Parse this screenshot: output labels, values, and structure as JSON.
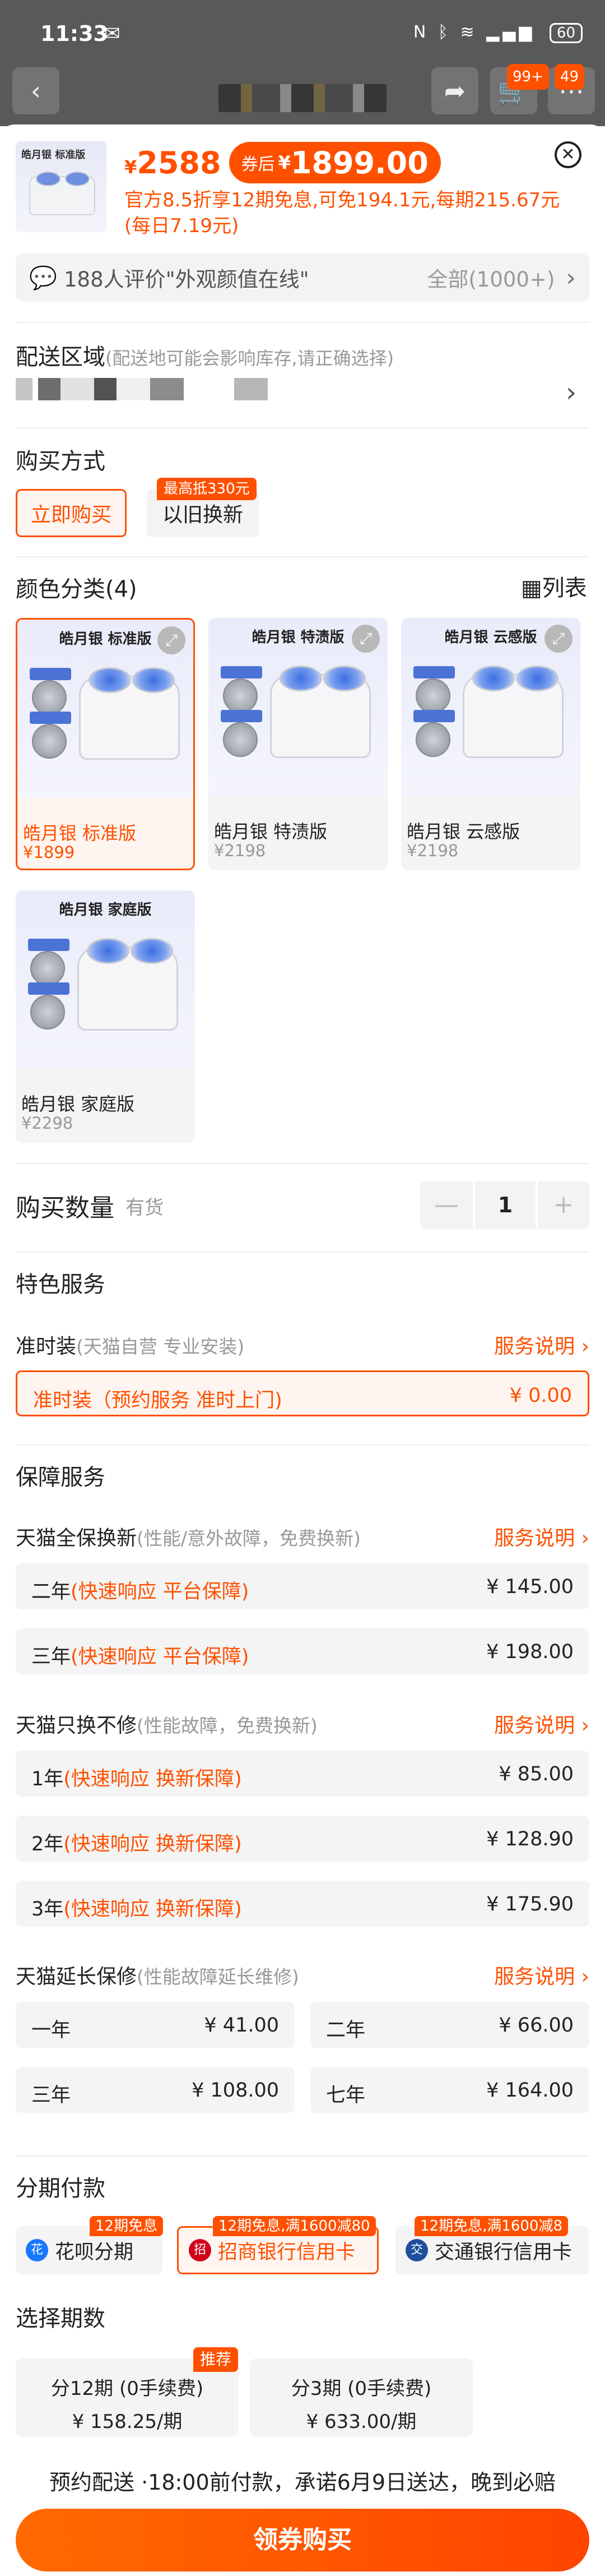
{
  "status_bar": {
    "time": "11:33",
    "app_icon": "wechat-icon",
    "battery": "60"
  },
  "nav": {
    "cart_badge": "99+",
    "more_badge": "49"
  },
  "product": {
    "thumb_tag": "皓月银 标准版",
    "yen": "¥",
    "price": "2588",
    "coupon_label": "券后",
    "coupon_price": "1899.00",
    "promo": "官方8.5折享12期免息,可免194.1元,每期215.67元(每日7.19元)"
  },
  "reviews": {
    "text": "188人评价\"外观颜值在线\"",
    "all": "全部(1000+)"
  },
  "delivery_area": {
    "title": "配送区域",
    "hint": "(配送地可能会影响库存,请正确选择)"
  },
  "purchase_method": {
    "title": "购买方式",
    "buy_now": "立即购买",
    "trade_in": "以旧换新",
    "trade_in_badge": "最高抵330元"
  },
  "colors": {
    "title": "颜色分类(4)",
    "list_toggle": "列表",
    "variants": [
      {
        "tag": "皓月银 标准版",
        "name": "皓月银 标准版",
        "price": "¥1899"
      },
      {
        "tag": "皓月银 特渍版",
        "name": "皓月银 特渍版",
        "price": "¥2198"
      },
      {
        "tag": "皓月银 云感版",
        "name": "皓月银 云感版",
        "price": "¥2198"
      },
      {
        "tag": "皓月银 家庭版",
        "name": "皓月银 家庭版",
        "price": "¥2298"
      }
    ]
  },
  "quantity": {
    "label": "购买数量",
    "stock": "有货",
    "minus": "—",
    "value": "1",
    "plus": "+"
  },
  "special_service": {
    "title": "特色服务",
    "name": "准时装",
    "desc": "(天猫自营  专业安装)",
    "link": "服务说明",
    "option_label": "准时装（预约服务 准时上门)",
    "option_price": "¥ 0.00"
  },
  "guarantee": {
    "title": "保障服务",
    "full_replace": {
      "name": "天猫全保换新",
      "desc": "(性能/意外故障，免费换新)",
      "link": "服务说明",
      "options": [
        {
          "term": "二年",
          "note": "(快速响应 平台保障)",
          "price": "¥ 145.00"
        },
        {
          "term": "三年",
          "note": "(快速响应 平台保障)",
          "price": "¥ 198.00"
        }
      ]
    },
    "replace_only": {
      "name": "天猫只换不修",
      "desc": "(性能故障，免费换新)",
      "link": "服务说明",
      "options": [
        {
          "term": "1年",
          "note": "(快速响应 换新保障)",
          "price": "¥ 85.00"
        },
        {
          "term": "2年",
          "note": "(快速响应 换新保障)",
          "price": "¥ 128.90"
        },
        {
          "term": "3年",
          "note": "(快速响应 换新保障)",
          "price": "¥ 175.90"
        }
      ]
    },
    "extended": {
      "name": "天猫延长保修",
      "desc": "(性能故障延长维修)",
      "link": "服务说明",
      "options": [
        {
          "term": "一年",
          "price": "¥ 41.00"
        },
        {
          "term": "二年",
          "price": "¥ 66.00"
        },
        {
          "term": "三年",
          "price": "¥ 108.00"
        },
        {
          "term": "七年",
          "price": "¥ 164.00"
        }
      ]
    }
  },
  "installment": {
    "title": "分期付款",
    "methods": [
      {
        "label": "花呗分期",
        "badge": "12期免息",
        "icon": "huabei-icon"
      },
      {
        "label": "招商银行信用卡",
        "badge": "12期免息,满1600减80",
        "icon": "cmb-icon"
      },
      {
        "label": "交通银行信用卡",
        "badge": "12期免息,满1600减8",
        "icon": "bocom-icon"
      }
    ]
  },
  "periods": {
    "title": "选择期数",
    "badge": "推荐",
    "options": [
      {
        "label": "分12期 (0手续费)",
        "amount": "¥ 158.25/期"
      },
      {
        "label": "分3期 (0手续费)",
        "amount": "¥ 633.00/期"
      }
    ]
  },
  "delivery_note": "预约配送 ·18:00前付款，承诺6月9日送达，晚到必赔",
  "cta": "领券购买",
  "colors_theme": {
    "accent": "#ff5000",
    "option_bg": "#f4f4f4",
    "selected_bg": "#fff5f0"
  }
}
